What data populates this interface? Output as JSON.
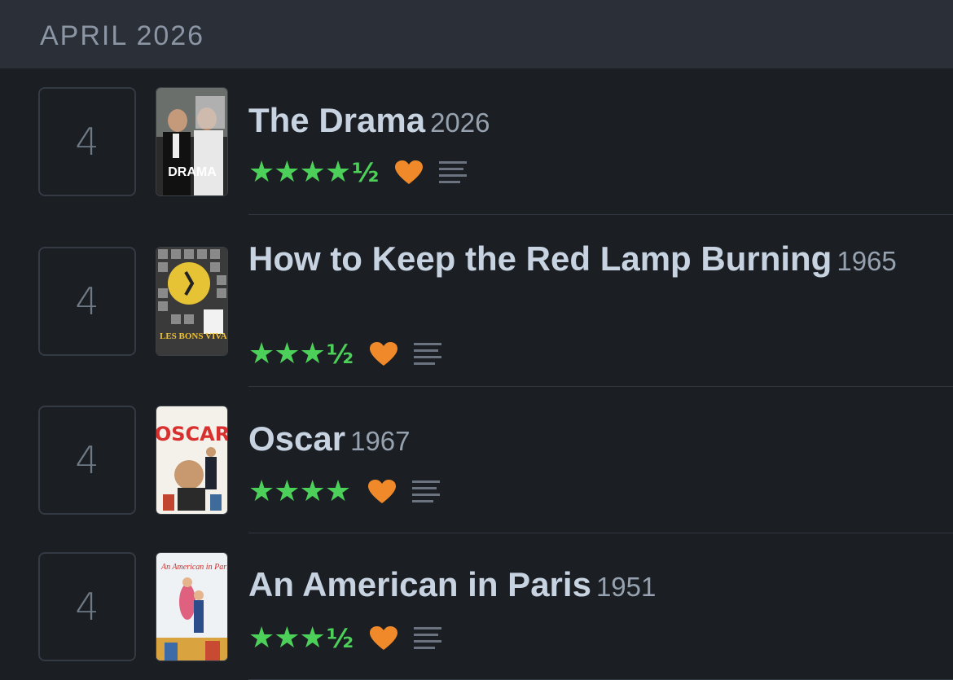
{
  "month_header": "APRIL 2026",
  "colors": {
    "star": "#4cd05a",
    "heart": "#f0892a",
    "text": "#c8d3e1"
  },
  "entries": [
    {
      "day": "4",
      "title": "The Drama",
      "year": "2026",
      "stars": "★★★★",
      "half": "½",
      "rating": 4.5,
      "liked": true,
      "has_review": true,
      "poster_text": "DRAMA"
    },
    {
      "day": "4",
      "title": "How to Keep the Red Lamp Burning",
      "year": "1965",
      "stars": "★★★",
      "half": "½",
      "rating": 3.5,
      "liked": true,
      "has_review": true,
      "poster_text": "LES BONS VIVANTS"
    },
    {
      "day": "4",
      "title": "Oscar",
      "year": "1967",
      "stars": "★★★★",
      "half": "",
      "rating": 4,
      "liked": true,
      "has_review": true,
      "poster_text": "OSCAR"
    },
    {
      "day": "4",
      "title": "An American in Paris",
      "year": "1951",
      "stars": "★★★",
      "half": "½",
      "rating": 3.5,
      "liked": true,
      "has_review": true,
      "poster_text": "An American in Paris"
    }
  ]
}
